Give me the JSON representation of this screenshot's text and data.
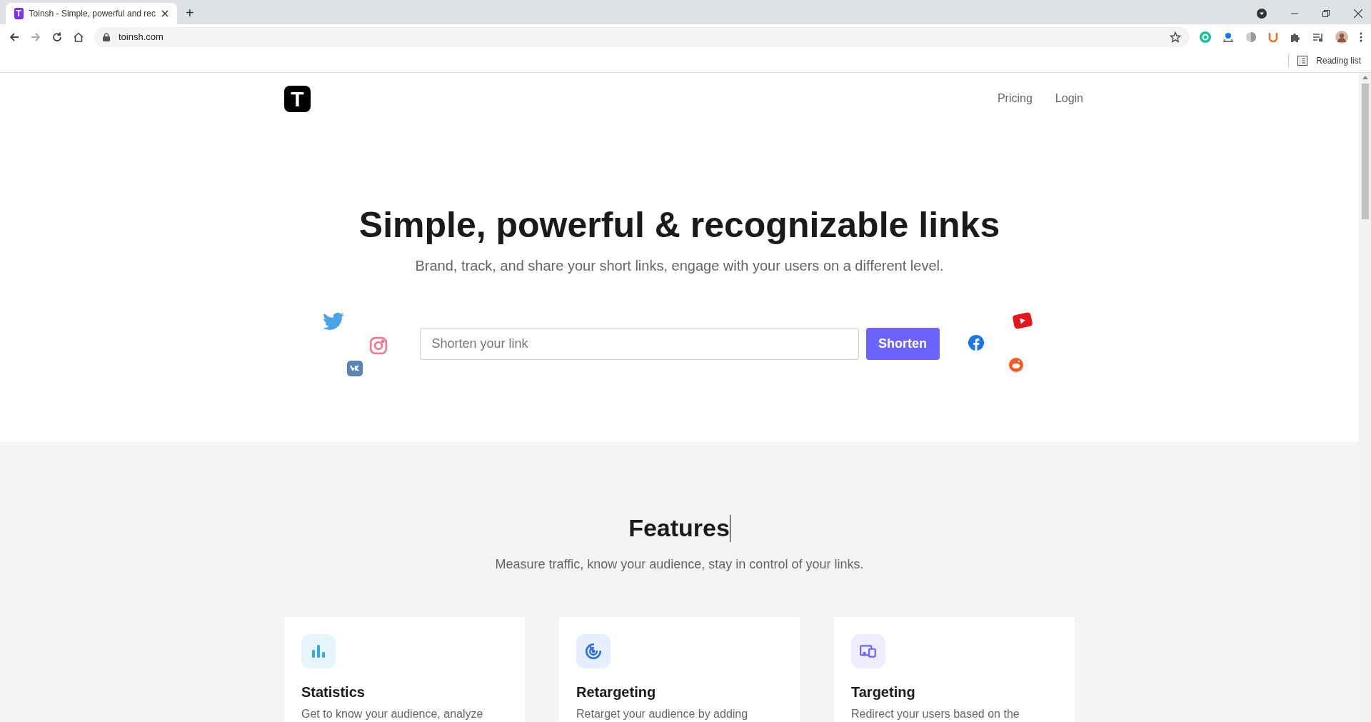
{
  "browser": {
    "tab": {
      "title": "Toinsh - Simple, powerful and rec",
      "favicon": "T",
      "selected": true
    },
    "new_tab": "+",
    "url": "toinsh.com",
    "reading_list": "Reading list"
  },
  "site": {
    "logo": "T",
    "nav": [
      {
        "label": "Pricing"
      },
      {
        "label": "Login"
      }
    ]
  },
  "hero": {
    "title": "Simple, powerful & recognizable links",
    "subtitle": "Brand, track, and share your short links, engage with your users on a different level.",
    "input": {
      "placeholder": "Shorten your link"
    },
    "button": "Shorten"
  },
  "features": {
    "title": "Features",
    "subtitle": "Measure traffic, know your audience, stay in control of your links.",
    "cards": [
      {
        "kind": "statistics",
        "title": "Statistics",
        "description": "Get to know your audience, analyze"
      },
      {
        "kind": "retargeting",
        "title": "Retargeting",
        "description": "Retarget your audience by adding"
      },
      {
        "kind": "targeting",
        "title": "Targeting",
        "description": "Redirect your users based on the"
      }
    ]
  }
}
